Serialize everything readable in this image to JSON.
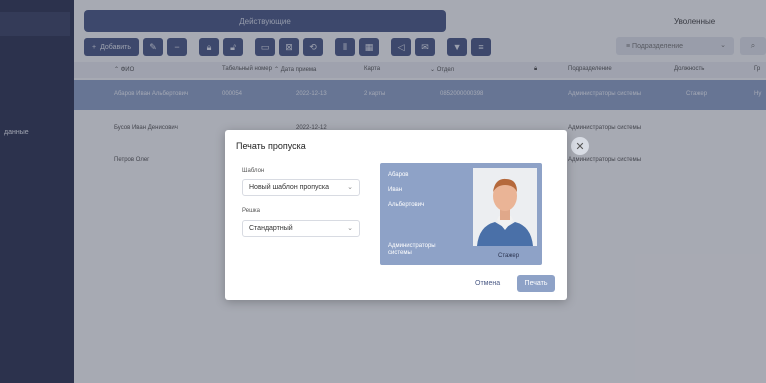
{
  "sidebar": {
    "item_label": "данные"
  },
  "tabs": {
    "active": "Действующие",
    "other": "Уволенные"
  },
  "toolbar": {
    "add_label": "Добавить",
    "filter_placeholder": "Подразделение",
    "icons": [
      "pencil-icon",
      "minus-icon",
      "lock-icon",
      "unlock-icon",
      "card-icon",
      "card-cancel-icon",
      "card-refresh-icon",
      "columns-icon",
      "columns-alt-icon",
      "send-icon",
      "message-icon",
      "filter-icon",
      "list-icon",
      "search-icon"
    ]
  },
  "table": {
    "columns": [
      "ФИО",
      "Табельный номер",
      "Дата приема",
      "Карта",
      "Отдел",
      "Подразделение",
      "Должность",
      "Гр"
    ],
    "rows": [
      {
        "name": "Абаров Иван Альбертович",
        "tab": "000054",
        "date": "2022-12-13",
        "card": "2 карты",
        "dept": "0852000000398",
        "unit": "Администраторы системы",
        "pos": "Стажер",
        "gr": "Ну"
      },
      {
        "name": "Бусов Иван Денисович",
        "tab": "",
        "date": "2022-12-12",
        "card": "",
        "dept": "",
        "unit": "Администраторы системы",
        "pos": "",
        "gr": ""
      },
      {
        "name": "Петров Олег",
        "tab": "",
        "date": "",
        "card": "",
        "dept": "",
        "unit": "Администраторы системы",
        "pos": "",
        "gr": ""
      }
    ]
  },
  "dialog": {
    "title": "Печать пропуска",
    "template_label": "Шаблон",
    "template_value": "Новый шаблон пропуска",
    "solution_label": "Решка",
    "solution_value": "Стандартный",
    "cancel_label": "Отмена",
    "print_label": "Печать",
    "card": {
      "last_name": "Абаров",
      "first_name": "Иван",
      "middle_name": "Альбертович",
      "unit": "Администраторы системы",
      "position": "Стажер"
    }
  },
  "colors": {
    "sidebar": "#2f3654",
    "accent": "#4b5a86",
    "selected_row": "#8ea2c7"
  }
}
